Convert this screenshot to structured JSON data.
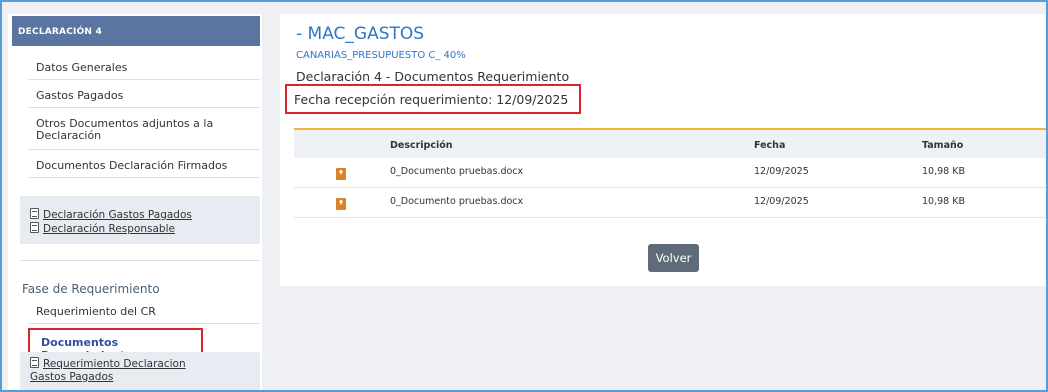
{
  "sidebar": {
    "header": "DECLARACIÓN 4",
    "items": [
      {
        "label": "Datos Generales"
      },
      {
        "label": "Gastos Pagados"
      },
      {
        "label": "Otros Documentos adjuntos a la Declaración"
      },
      {
        "label": "Documentos Declaración Firmados"
      }
    ],
    "declaration_docs": [
      {
        "label": "Declaración Gastos Pagados"
      },
      {
        "label": "Declaración Responsable"
      }
    ],
    "section_title": "Fase de Requerimiento",
    "requerimiento_items": [
      {
        "label": "Requerimiento del CR"
      },
      {
        "label": "Documentos Requerimiento"
      }
    ],
    "requerimiento_docs": [
      {
        "label": "Requerimiento Declaracion Gastos Pagados"
      }
    ]
  },
  "main": {
    "title": "- MAC_GASTOS",
    "subtitle": "CANARIAS_PRESUPUESTO C_ 40%",
    "declaration_title": "Declaración 4 - Documentos Requerimiento",
    "fecha_recepcion": "Fecha recepción requerimiento: 12/09/2025",
    "table": {
      "headers": [
        "Descripción",
        "Fecha",
        "Tamaño"
      ],
      "rows": [
        {
          "descripcion": "0_Documento pruebas.docx",
          "fecha": "12/09/2025",
          "tamano": "10,98 KB"
        },
        {
          "descripcion": "0_Documento pruebas.docx",
          "fecha": "12/09/2025",
          "tamano": "10,98 KB"
        }
      ]
    },
    "volver_label": "Volver"
  },
  "colors": {
    "accent_blue": "#2e75c7",
    "sidebar_header": "#5a75a0",
    "highlight_red": "#d9262c",
    "table_top_border": "#f0b43c",
    "download_icon": "#d9822b",
    "button_bg": "#5f6b78"
  }
}
